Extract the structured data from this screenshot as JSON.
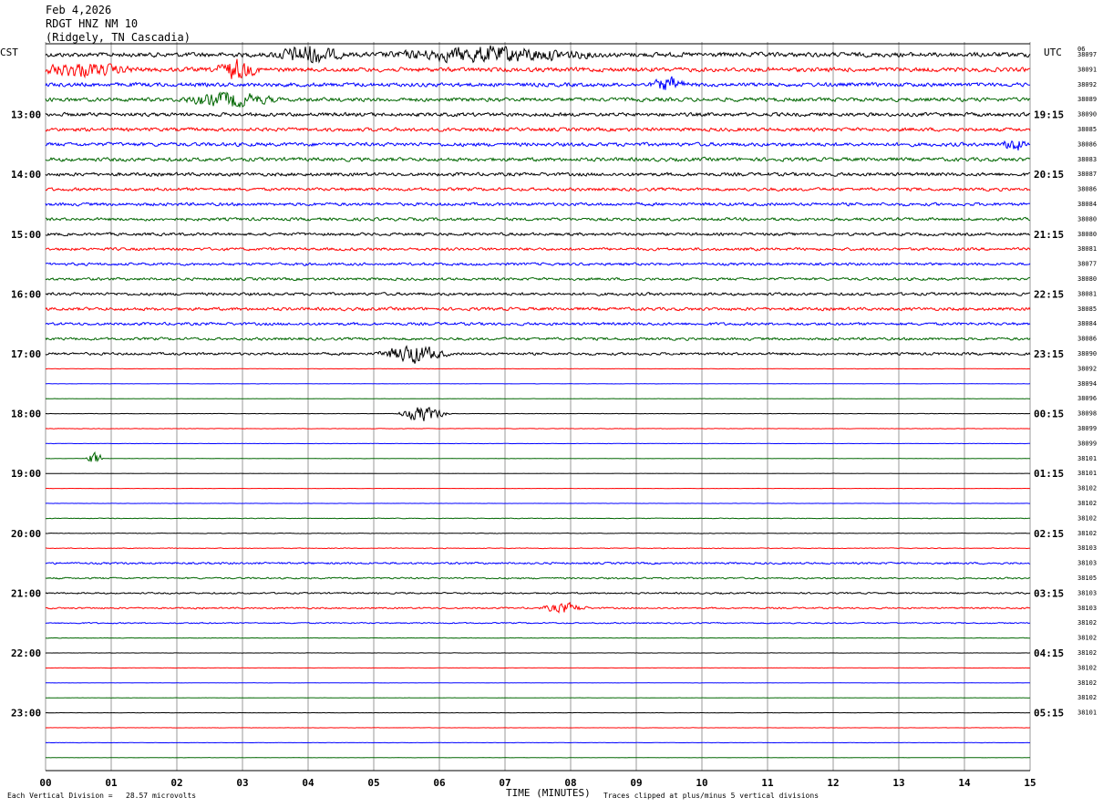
{
  "header": {
    "date": "Feb 4,2026",
    "station": "RDGT HNZ NM 10",
    "location": "(Ridgely, TN Cascadia)"
  },
  "chart_data": {
    "type": "line",
    "title": "Feb 4,2026 RDGT HNZ NM 10 (Ridgely, TN Cascadia)",
    "left_axis_label": "CST",
    "right_axis_label": "UTC",
    "xlabel": "TIME (MINUTES)",
    "x_ticks": [
      "00",
      "01",
      "02",
      "03",
      "04",
      "05",
      "06",
      "07",
      "08",
      "09",
      "10",
      "11",
      "12",
      "13",
      "14",
      "15"
    ],
    "xlim": [
      0,
      15
    ],
    "grid": true,
    "trace_colors": [
      "#000000",
      "#ff0000",
      "#0000ff",
      "#006600"
    ],
    "left_hour_labels": [
      "13:00",
      "14:00",
      "15:00",
      "16:00",
      "17:00",
      "18:00",
      "19:00",
      "20:00",
      "21:00",
      "22:00",
      "23:00"
    ],
    "right_hour_labels": [
      "19:15",
      "20:15",
      "21:15",
      "22:15",
      "23:15",
      "00:15",
      "01:15",
      "02:15",
      "03:15",
      "04:15",
      "05:15"
    ],
    "row_values": [
      "06",
      "38097",
      "38091",
      "38092",
      "38089",
      "38090",
      "38085",
      "38086",
      "38083",
      "38087",
      "38086",
      "38084",
      "38080",
      "38080",
      "38081",
      "38077",
      "38080",
      "38081",
      "38085",
      "38084",
      "38086",
      "38090",
      "38092",
      "38094",
      "38096",
      "38098",
      "38099",
      "38099",
      "38101",
      "38101",
      "38102",
      "38102",
      "38102",
      "38102",
      "38103",
      "38103",
      "38105",
      "38103",
      "38103",
      "38102",
      "38102",
      "38102",
      "38102",
      "38102",
      "38102",
      "38101"
    ],
    "trace_amplitude": [
      3.2,
      3.0,
      2.8,
      2.7,
      2.6,
      2.5,
      2.6,
      2.6,
      2.4,
      2.2,
      2.2,
      2.1,
      2.0,
      2.0,
      1.9,
      1.9,
      2.0,
      2.2,
      2.0,
      1.9,
      1.8,
      0.25,
      0.22,
      0.22,
      0.28,
      0.3,
      0.22,
      0.22,
      0.18,
      0.18,
      0.18,
      0.45,
      0.4,
      0.5,
      1.4,
      1.1,
      1.1,
      1.1,
      0.9,
      0.35,
      0.2,
      0.2,
      0.2,
      0.2,
      0.2,
      0.2,
      0.2,
      0.2
    ],
    "events": [
      {
        "trace": 0,
        "minute": 4.0,
        "width": 0.6,
        "amp": 4.5
      },
      {
        "trace": 0,
        "minute": 6.8,
        "width": 1.8,
        "amp": 3.5
      },
      {
        "trace": 1,
        "minute": 0.5,
        "width": 1.0,
        "amp": 3.0
      },
      {
        "trace": 1,
        "minute": 2.9,
        "width": 0.4,
        "amp": 4.5
      },
      {
        "trace": 2,
        "minute": 9.5,
        "width": 0.3,
        "amp": 3.5
      },
      {
        "trace": 3,
        "minute": 2.8,
        "width": 0.8,
        "amp": 3.5
      },
      {
        "trace": 6,
        "minute": 14.75,
        "width": 0.2,
        "amp": 3.5
      },
      {
        "trace": 20,
        "minute": 5.6,
        "width": 0.6,
        "amp": 4.5
      },
      {
        "trace": 24,
        "minute": 5.75,
        "width": 0.45,
        "amp": 4.0
      },
      {
        "trace": 27,
        "minute": 0.75,
        "width": 0.15,
        "amp": 4.0
      },
      {
        "trace": 37,
        "minute": 7.9,
        "width": 0.4,
        "amp": 2.5
      }
    ]
  },
  "footer": {
    "scale_note": "Each Vertical Division =   28.57 microvolts",
    "clip_note": "Traces clipped at plus/minus 5 vertical divisions"
  }
}
